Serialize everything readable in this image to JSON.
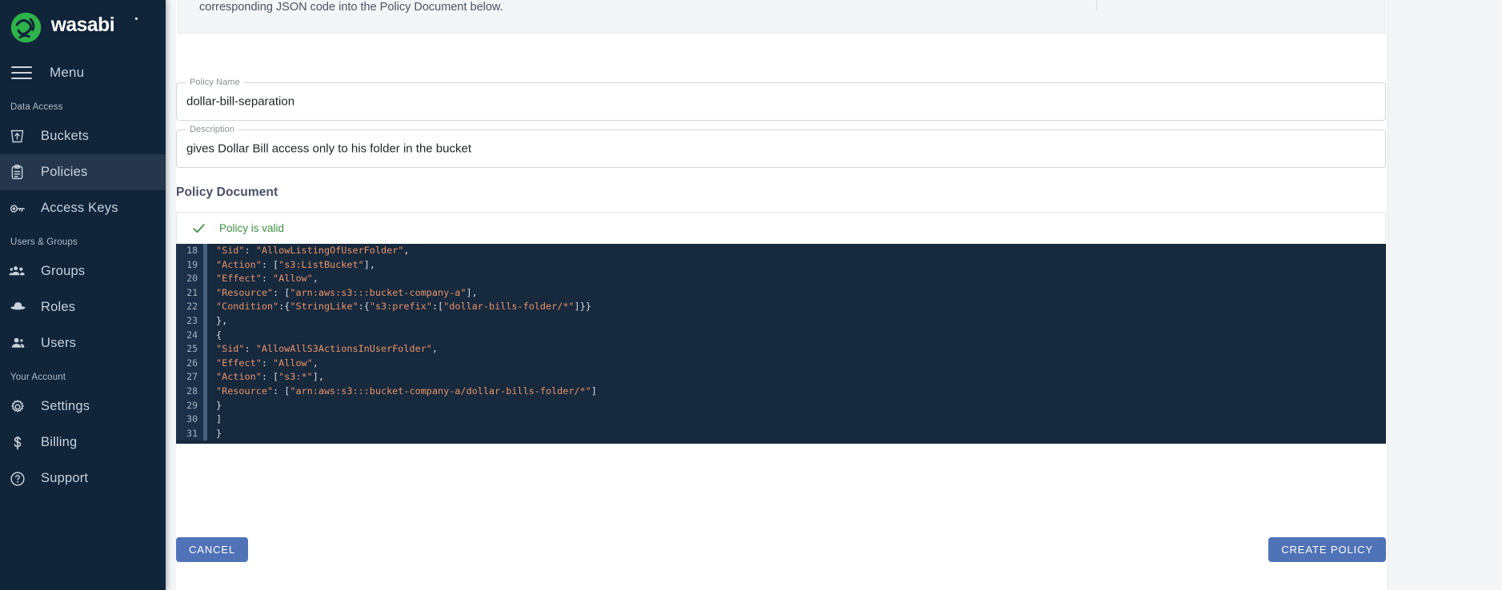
{
  "brand": {
    "name": "wasabi",
    "logo_icon": "wasabi-logo-icon",
    "accent_color": "#2eb34a"
  },
  "sidebar": {
    "menu_label": "Menu",
    "menu_icon": "hamburger-icon",
    "groups": [
      {
        "label": "Data Access",
        "items": [
          {
            "label": "Buckets",
            "icon": "bucket-icon",
            "active": false
          },
          {
            "label": "Policies",
            "icon": "clipboard-icon",
            "active": true
          },
          {
            "label": "Access Keys",
            "icon": "key-icon",
            "active": false
          }
        ]
      },
      {
        "label": "Users & Groups",
        "items": [
          {
            "label": "Groups",
            "icon": "groups-icon",
            "active": false
          },
          {
            "label": "Roles",
            "icon": "hat-icon",
            "active": false
          },
          {
            "label": "Users",
            "icon": "user-icon",
            "active": false
          }
        ]
      },
      {
        "label": "Your Account",
        "items": [
          {
            "label": "Settings",
            "icon": "gear-icon",
            "active": false
          },
          {
            "label": "Billing",
            "icon": "dollar-icon",
            "active": false
          },
          {
            "label": "Support",
            "icon": "question-circle-icon",
            "active": false
          }
        ]
      }
    ]
  },
  "banner": {
    "text": "corresponding JSON code into the Policy Document below."
  },
  "form": {
    "policy_name": {
      "legend": "Policy Name",
      "value": "dollar-bill-separation"
    },
    "description": {
      "legend": "Description",
      "value": "gives Dollar Bill access only to his folder in the bucket"
    }
  },
  "policy_document": {
    "title": "Policy Document",
    "validation": {
      "icon": "check-icon",
      "text": "Policy is valid",
      "color": "#3f8f3f"
    },
    "editor": {
      "background": "#17293d",
      "gutter_background": "#1c3049",
      "string_color": "#e8946a",
      "punctuation_color": "#d7dde4",
      "first_visible_line": 18,
      "last_visible_line": 31,
      "lines": [
        {
          "num": "18",
          "code": "\"Sid\": \"AllowListingOfUserFolder\","
        },
        {
          "num": "19",
          "code": "\"Action\": [\"s3:ListBucket\"],"
        },
        {
          "num": "20",
          "code": "\"Effect\": \"Allow\","
        },
        {
          "num": "21",
          "code": "\"Resource\": [\"arn:aws:s3:::bucket-company-a\"],"
        },
        {
          "num": "22",
          "code": "\"Condition\":{\"StringLike\":{\"s3:prefix\":[\"dollar-bills-folder/*\"]}}"
        },
        {
          "num": "23",
          "code": "},"
        },
        {
          "num": "24",
          "code": "{"
        },
        {
          "num": "25",
          "code": "\"Sid\": \"AllowAllS3ActionsInUserFolder\","
        },
        {
          "num": "26",
          "code": "\"Effect\": \"Allow\","
        },
        {
          "num": "27",
          "code": "\"Action\": [\"s3:*\"],"
        },
        {
          "num": "28",
          "code": "\"Resource\": [\"arn:aws:s3:::bucket-company-a/dollar-bills-folder/*\"]"
        },
        {
          "num": "29",
          "code": "}"
        },
        {
          "num": "30",
          "code": "]"
        },
        {
          "num": "31",
          "code": "}"
        }
      ]
    }
  },
  "actions": {
    "cancel_label": "CANCEL",
    "create_label": "CREATE POLICY",
    "button_color": "#5073b8"
  }
}
